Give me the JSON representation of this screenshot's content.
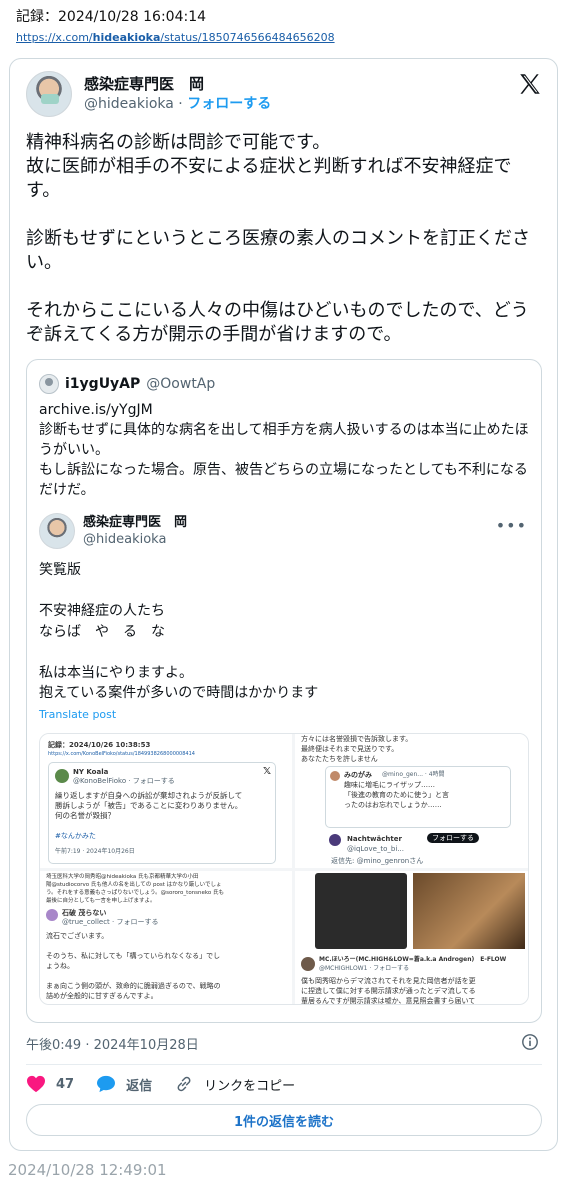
{
  "record": {
    "title": "記録：2024/10/28 16:04:14",
    "link_prefix": "https://x.com/",
    "link_user": "hideakioka",
    "link_suffix": "/status/1850746566484656208"
  },
  "tweet": {
    "author_name": "感染症専門医　岡",
    "handle": "@hideakioka",
    "separator": " · ",
    "follow_label": "フォローする",
    "text": "精神科病名の診断は問診で可能です。\n故に医師が相手の不安による症状と判断すれば不安神経症です。\n\n診断もせずにというところ医療の素人のコメントを訂正ください。\n\nそれからここにいる人々の中傷はひどいものでしたので、どうぞ訴えてくる方が開示の手間が省けますので。",
    "timestamp": "午後0:49 · 2024年10月28日"
  },
  "quote": {
    "author_name": "i1ygUyAP",
    "handle": "@OowtAp",
    "text": "archive.is/yYgJM\n診断もせずに具体的な病名を出して相手方を病人扱いするのは本当に止めたほうがいい。\nもし訴訟になった場合。原告、被告どちらの立場になったとしても不利になるだけだ。",
    "inner": {
      "author_name": "感染症専門医　岡",
      "handle": "@hideakioka",
      "more": "•••",
      "body": "笑覧版\n\n不安神経症の人たち\nならば　や　る　な\n\n私は本当にやりますよ。\n抱えている案件が多いので時間はかかります",
      "translate_label": "Translate post"
    },
    "screenshots": {
      "s1": {
        "record": "記録：2024/10/26 10:38:53",
        "link": "https://x.com/KonoBelFioko/status/1849938268000008414",
        "name": "NY Koala",
        "handle": "@KonoBelFioko · フォローする",
        "text": "繰り返しますが自身への訴訟が棄却されようが反訴して\n勝訴しようが「被告」であることに変わりありません。\n何の名誉が毀損？",
        "hashtag": "#なんかみた",
        "time": "午前7:19 · 2024年10月26日"
      },
      "s2": {
        "text1": "方々には名誉毀損で告訴致します。\n最終便はそれまで見送りです。\nあなたたちを許しません",
        "name1": "みのがみ",
        "handle1": "@mino_gen... · 4時間",
        "text2": "趣味に増毛にライザップ……\n「後進の教育のために使う」と言\nったのはお忘れでしょうか……",
        "name2": "Nachtwächter",
        "follow2": "フォローする",
        "handle2": "@iqLove_to_bi...",
        "reply_to": "返信先: @mino_genronさん"
      },
      "s3": {
        "text1": "埼玉医科大学の岡秀昭@hideakioka 氏も京都精華大学の小田\n陽@studiocorvo 氏も他人の名を出しての post はかなり厳しいでしょ\nう。それをする意義もさっぱりないでしょう。@sororo_tonsneko 氏も\n最後に自分としても一言を申し上げますよ。",
        "name": "石破 茂らない",
        "handle": "@true_collect · フォローする",
        "text2": "流石でございます。\n\nそのうち、私に対しても「構っていられなくなる」でし\nょうね。\n\nまぁ向こう側の頭が、致命的に脆弱過ぎるので、戦略の\n詰めが全般的に甘すぎるんですよ。"
      },
      "s4": {
        "name": "MC.ほいろー(MC.HIGH&LOW=蒼a.k.a Androgen)　E-FLOW",
        "handle": "@MCHIGHLOW1 · フォローする",
        "text": "僕も岡秀昭からデマ流されてそれを見た岡信者が話を更\nに捏造して僕に対する開示請求が通ったとデマ流してる\n輩居るんですが開示請求は嘘か、意見照会書すら届いて"
      }
    }
  },
  "actions": {
    "like_count": "47",
    "reply_label": "返信",
    "copy_label": "リンクをコピー",
    "read_replies_label": "1件の返信を読む"
  },
  "footer": {
    "timestamp": "2024/10/28 12:49:01"
  },
  "colors": {
    "link_blue": "#1d9bf0",
    "like_pink": "#f91880",
    "reply_blue": "#1d9bf0",
    "muted": "#536471"
  }
}
